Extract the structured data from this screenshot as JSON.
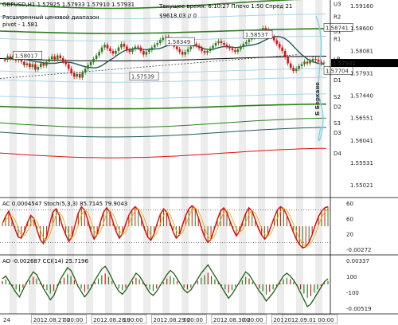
{
  "header": {
    "symbol_line": "GBPUSD,H1  1.57925 1.57933 1.57910 1.57931",
    "calc_label": "Расширенный ценовой диапазон",
    "pivot_label": "pivot - 1.581",
    "time_label": "Текущее время: 6:10:27 Плечо 1:50 Спред 21",
    "balance_label": "$9618.03  // 0"
  },
  "colors": {
    "bull": "#2e7d1f",
    "bear": "#d11",
    "pivot": "#1d5a5a",
    "support": "#9ed6c3",
    "resist": "#c9e7ee",
    "price_tag": "#000"
  },
  "chart_data": [
    {
      "type": "line",
      "panel": "price",
      "title": "GBPUSD,H1",
      "price_axis": [
        "1.59160",
        "1.58600",
        "1.58081",
        "1.57931",
        "1.57440",
        "1.56551",
        "1.56041",
        "1.55531",
        "1.55021"
      ],
      "ylim": [
        1.5495,
        1.5935
      ],
      "levels": [
        {
          "name": "U3",
          "value": 1.5927
        },
        {
          "name": "R2",
          "value": 1.5898
        },
        {
          "name": "U1",
          "value": 1.5865
        },
        {
          "name": "R1",
          "value": 1.5848
        },
        {
          "name": "LB",
          "value": 1.5803
        },
        {
          "name": "S1",
          "value": 1.5775
        },
        {
          "name": "D1",
          "value": 1.5755
        },
        {
          "name": "S2",
          "value": 1.5718
        },
        {
          "name": "D2",
          "value": 1.5695
        },
        {
          "name": "S3",
          "value": 1.5658
        },
        {
          "name": "D3",
          "value": 1.5637
        },
        {
          "name": "D4",
          "value": 1.559
        }
      ],
      "price_annotations": [
        {
          "text": "1.58017",
          "x": 3,
          "y": 1.5805
        },
        {
          "text": "1.57539",
          "x": 45,
          "y": 1.5758
        },
        {
          "text": "1.58349",
          "x": 58,
          "y": 1.5836
        },
        {
          "text": "1.58537",
          "x": 86,
          "y": 1.5852
        },
        {
          "text": "1.58741",
          "x": 123,
          "y": 1.5868
        },
        {
          "text": "1.57704",
          "x": 139,
          "y": 1.5771
        }
      ],
      "current_price": "1.57931",
      "side_label": "Б Беркане",
      "close": [
        1.58,
        1.5808,
        1.5803,
        1.581,
        1.5799,
        1.5806,
        1.5796,
        1.5788,
        1.5792,
        1.5784,
        1.579,
        1.5778,
        1.5784,
        1.5792,
        1.5787,
        1.5796,
        1.5802,
        1.5808,
        1.5801,
        1.581,
        1.5804,
        1.5796,
        1.579,
        1.578,
        1.577,
        1.5762,
        1.5768,
        1.576,
        1.5772,
        1.578,
        1.5788,
        1.5795,
        1.5802,
        1.581,
        1.5818,
        1.5828,
        1.5834,
        1.5826,
        1.582,
        1.5814,
        1.582,
        1.5828,
        1.5836,
        1.583,
        1.5822,
        1.5818,
        1.5824,
        1.583,
        1.5828,
        1.582,
        1.5812,
        1.5818,
        1.5822,
        1.5828,
        1.5834,
        1.5838,
        1.5845,
        1.585,
        1.5852,
        1.5846,
        1.5838,
        1.583,
        1.5824,
        1.5818,
        1.5812,
        1.5818,
        1.5824,
        1.583,
        1.5836,
        1.5832,
        1.5826,
        1.582,
        1.5816,
        1.582,
        1.5826,
        1.5832,
        1.5838,
        1.5842,
        1.5838,
        1.5834,
        1.583,
        1.5826,
        1.5822,
        1.5818,
        1.5824,
        1.583,
        1.5836,
        1.584,
        1.5846,
        1.585,
        1.5856,
        1.586,
        1.5866,
        1.5872,
        1.5868,
        1.586,
        1.5852,
        1.5844,
        1.5836,
        1.5828,
        1.582,
        1.5806,
        1.5792,
        1.5782,
        1.5775,
        1.578,
        1.5786,
        1.579,
        1.5796,
        1.5792,
        1.5798,
        1.5802,
        1.58,
        1.5796,
        1.5792,
        1.5794
      ]
    },
    {
      "type": "line",
      "panel": "stochastic",
      "title": "AC 0.0004547  Stoch(5,3,3) 85.7145 79.9043",
      "axis": [
        "60",
        "60",
        "20",
        "-0.00272"
      ],
      "ylim": [
        0,
        100
      ],
      "main": [
        55,
        68,
        78,
        62,
        45,
        30,
        28,
        40,
        58,
        70,
        64,
        42,
        25,
        18,
        30,
        55,
        76,
        82,
        70,
        50,
        35,
        22,
        30,
        52,
        74,
        86,
        80,
        62,
        40,
        26,
        35,
        58,
        76,
        84,
        76,
        58,
        40,
        28,
        36,
        54,
        70,
        80,
        86,
        80,
        64,
        44,
        30,
        24,
        36,
        56,
        72,
        82,
        76,
        58,
        40,
        28,
        34,
        52,
        70,
        82,
        88,
        82,
        66,
        46,
        30,
        20,
        26,
        44,
        62,
        78,
        84,
        76,
        60,
        44,
        32,
        40,
        58,
        74,
        84,
        78,
        62,
        46,
        34,
        26,
        34,
        50,
        66,
        80,
        86,
        82,
        70,
        56,
        40,
        26,
        16,
        10,
        12,
        20,
        34,
        52,
        68,
        78,
        84,
        86
      ]
    },
    {
      "type": "bar",
      "panel": "oscillator",
      "title": "AO -0.002687  CCI(14) 25.7196",
      "axis": [
        "0.00337",
        "100",
        "-100",
        "-0.00519"
      ],
      "ylim": [
        -200,
        200
      ],
      "values": [
        40,
        60,
        20,
        -20,
        -60,
        -90,
        -40,
        10,
        50,
        90,
        70,
        20,
        -30,
        -70,
        -110,
        -80,
        -20,
        40,
        80,
        120,
        100,
        50,
        -10,
        -50,
        -90,
        -60,
        -20,
        30,
        70,
        110,
        130,
        90,
        40,
        -10,
        -50,
        -70,
        -40,
        0,
        40,
        80,
        60,
        20,
        -20,
        -60,
        -80,
        -50,
        -10,
        30,
        70,
        100,
        80,
        40,
        0,
        -40,
        -60,
        -40,
        0,
        40,
        80,
        110,
        140,
        100,
        60,
        20,
        -20,
        -60,
        -100,
        -70,
        -30,
        10,
        50,
        90,
        70,
        30,
        -10,
        -50,
        -80,
        -120,
        -90,
        -60,
        -20,
        20,
        60,
        80,
        60,
        30,
        -10,
        -60,
        -110,
        -160,
        -140,
        -100,
        -60,
        -20,
        20,
        40
      ]
    }
  ],
  "x_axis": {
    "ticks": [
      "24",
      "2012.08.27 00:00",
      "02",
      "2012.08.28 00:00",
      "19",
      "2012.08.29 00:00",
      "02",
      "2012.08.30 00:00",
      "02",
      "2012.08.31 00:00",
      "02",
      "2012.09.01 00:00"
    ]
  }
}
